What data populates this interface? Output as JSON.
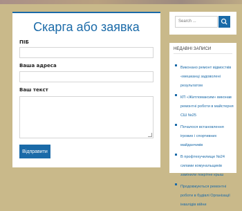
{
  "form": {
    "title": "Скарга або заявка",
    "name_label": "ПІБ",
    "address_label": "Ваша адреса",
    "text_label": "Ваш текст",
    "submit_label": "Відправити"
  },
  "sidebar": {
    "search": {
      "placeholder": "Search ..."
    },
    "recent_posts": {
      "title": "НЕДАВНІ ЗАПИСИ",
      "items": [
        {
          "label": "Виконано ремонт відмостків «мешканці задоволені результатом"
        },
        {
          "label": "КП «Житломаксим» виконав ремонтні роботи в майстерня СШ №25"
        },
        {
          "label": "Почалося встановлення ігрових і спортивних майданчиків"
        },
        {
          "label": "В профтехучилище №24 силами комунальщиків замінили покрітне крыш"
        },
        {
          "label": "Продовжуються ремонтні роботи в будівлі Організації інвалідів війни"
        }
      ]
    }
  },
  "colors": {
    "accent": "#1a6aa8",
    "page_background": "#c9b98a"
  },
  "icons": {
    "search_button": "search-icon",
    "list_bullet": "square-bullet-icon"
  }
}
